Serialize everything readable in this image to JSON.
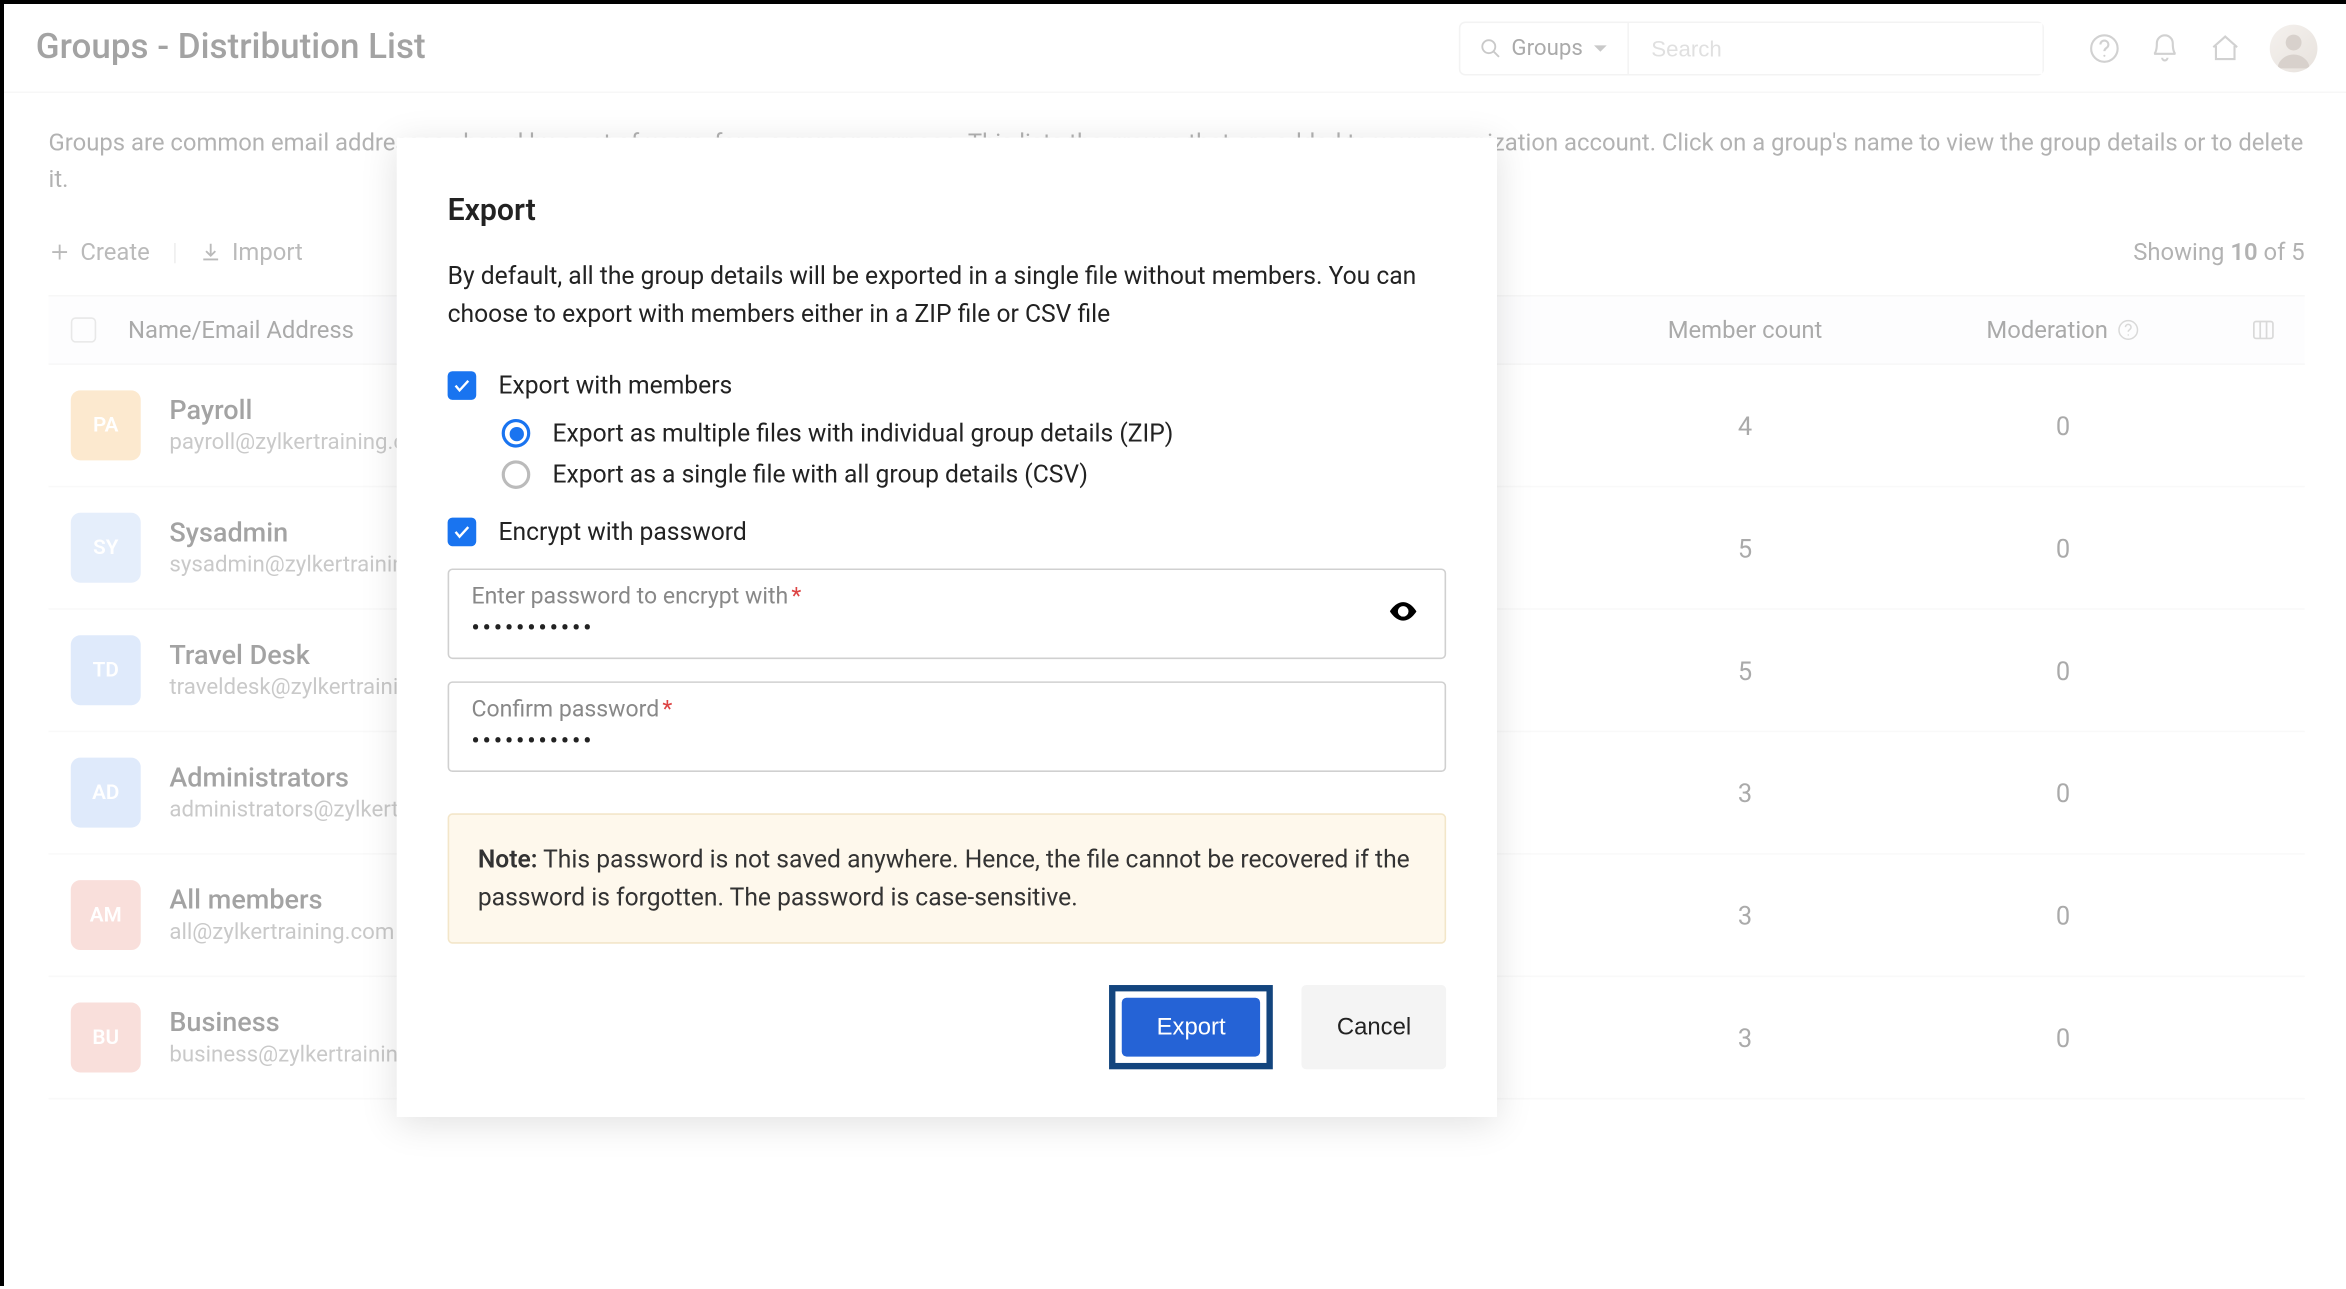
{
  "header": {
    "title": "Groups - Distribution List",
    "search_scope": "Groups",
    "search_placeholder": "Search"
  },
  "description": "Groups are common email addresses shared by a set of users, for a common purpose. This lists the groups that are added to your organization account. Click on a group's name to view the group details or to delete it.",
  "toolbar": {
    "create": "Create",
    "import": "Import",
    "showing_prefix": "Showing ",
    "showing_bold": "10",
    "showing_suffix": " of 5"
  },
  "table": {
    "headers": {
      "name": "Name/Email Address",
      "members": "Member count",
      "moderation": "Moderation"
    },
    "rows": [
      {
        "badge": "PA",
        "badge_color": "#f8cf94",
        "name": "Payroll",
        "email": "payroll@zylkertraining.com",
        "members": "4",
        "moderation": "0"
      },
      {
        "badge": "SY",
        "badge_color": "#c6d9f6",
        "name": "Sysadmin",
        "email": "sysadmin@zylkertraining.com",
        "members": "5",
        "moderation": "0"
      },
      {
        "badge": "TD",
        "badge_color": "#b9d0f6",
        "name": "Travel Desk",
        "email": "traveldesk@zylkertraining.com",
        "members": "5",
        "moderation": "0"
      },
      {
        "badge": "AD",
        "badge_color": "#b9d0f6",
        "name": "Administrators",
        "email": "administrators@zylkertraining.com",
        "members": "3",
        "moderation": "0"
      },
      {
        "badge": "AM",
        "badge_color": "#f2b9b0",
        "name": "All members",
        "email": "all@zylkertraining.com",
        "members": "3",
        "moderation": "0"
      },
      {
        "badge": "BU",
        "badge_color": "#f2b9b0",
        "name": "Business",
        "email": "business@zylkertraining.com",
        "members": "3",
        "moderation": "0"
      }
    ]
  },
  "modal": {
    "title": "Export",
    "description": "By default, all the group details will be exported in a single file without members. You can choose to export with members either in a ZIP file or CSV file",
    "export_with_members": "Export with members",
    "option_zip": "Export as multiple files with individual group details (ZIP)",
    "option_csv": "Export as a single file with all group details (CSV)",
    "encrypt": "Encrypt with password",
    "pwd_label": "Enter password to encrypt with",
    "pwd_value": "•••••••••••",
    "confirm_label": "Confirm password",
    "confirm_value": "•••••••••••",
    "note_prefix": "Note:",
    "note_body": " This password is not saved anywhere. Hence, the file cannot be recovered if the password is forgotten. The password is case-sensitive.",
    "export_btn": "Export",
    "cancel_btn": "Cancel"
  }
}
